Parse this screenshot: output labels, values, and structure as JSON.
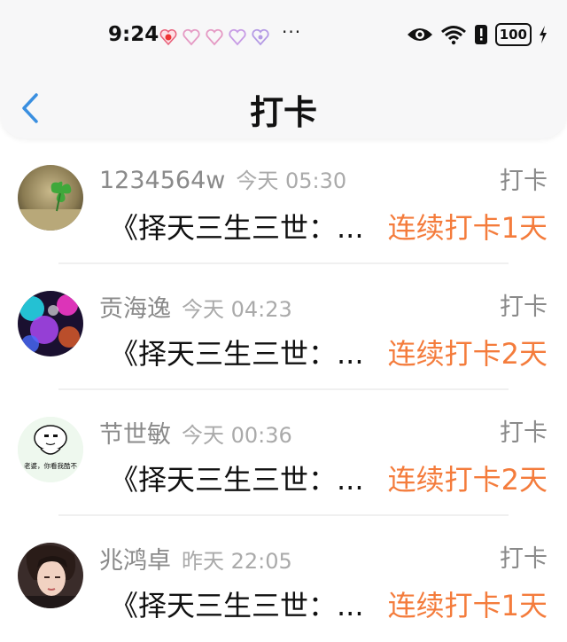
{
  "status": {
    "time": "9:24",
    "dots": "···",
    "battery": "100",
    "icons": [
      "notif-icon",
      "heart-icon",
      "heart-icon",
      "heart-icon",
      "heart-icon",
      "eye-icon",
      "wifi-icon",
      "alert-icon",
      "charging-icon"
    ]
  },
  "header": {
    "title": "打卡"
  },
  "items": [
    {
      "name": "1234564w",
      "time": "今天 05:30",
      "tag": "打卡",
      "text": "《择天三生三世：...",
      "streak": "连续打卡1天"
    },
    {
      "name": "贡海逸",
      "time": "今天 04:23",
      "tag": "打卡",
      "text": "《择天三生三世：...",
      "streak": "连续打卡2天"
    },
    {
      "name": "节世敏",
      "time": "今天 00:36",
      "tag": "打卡",
      "text": "《择天三生三世：...",
      "streak": "连续打卡2天"
    },
    {
      "name": "兆鸿卓",
      "time": "昨天 22:05",
      "tag": "打卡",
      "text": "《择天三生三世：...",
      "streak": "连续打卡1天"
    }
  ],
  "avatar3_caption": "老婆，你看我酷不",
  "colors": {
    "accent": "#f47c3c",
    "back": "#3a8fe0"
  }
}
